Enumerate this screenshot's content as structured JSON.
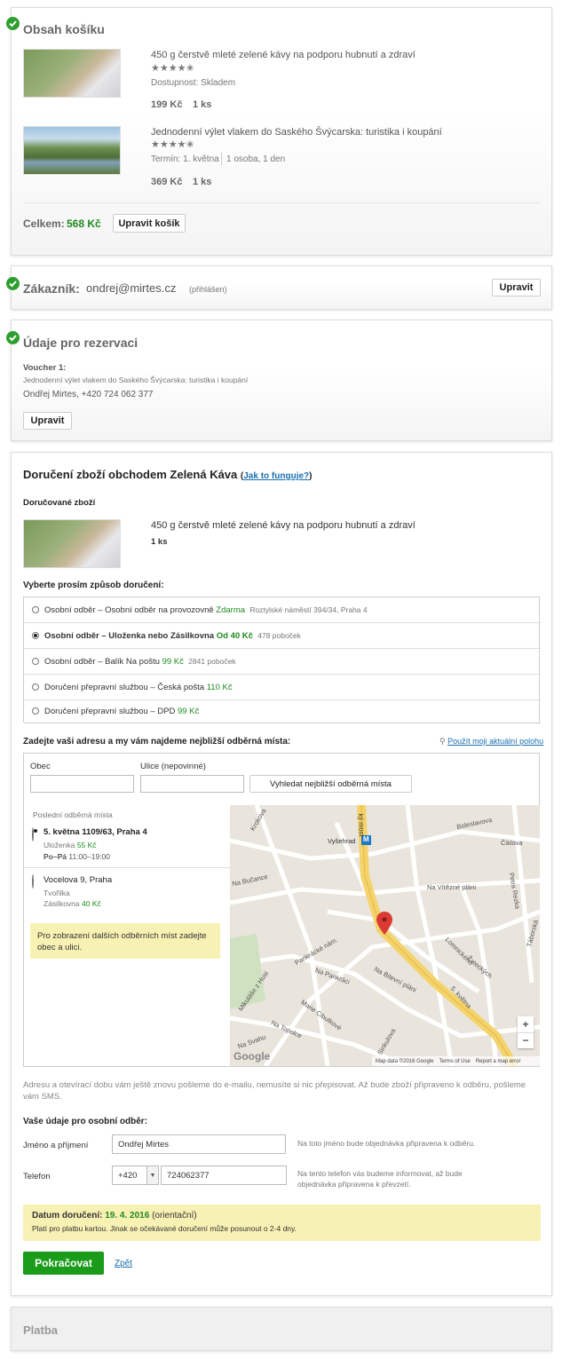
{
  "cart": {
    "title": "Obsah košíku",
    "items": [
      {
        "name": "450 g čerstvě mleté zelené kávy na podporu hubnutí a zdraví",
        "stars": "★★★★✬",
        "availability": "Dostupnost: Skladem",
        "price": "199 Kč",
        "qty": "1 ks"
      },
      {
        "name": "Jednodenní výlet vlakem do Saského Švýcarska: turistika i koupání",
        "stars": "★★★★✬",
        "term": "Termín: 1. května",
        "persons": "1 osoba, 1 den",
        "price": "369 Kč",
        "qty": "1 ks"
      }
    ],
    "total_label": "Celkem:",
    "total_value": "568 Kč",
    "edit_button": "Upravit košík"
  },
  "customer": {
    "label": "Zákazník:",
    "email": "ondrej@mirtes.cz",
    "status": "(přihlášen)",
    "edit_button": "Upravit"
  },
  "reservation": {
    "title": "Údaje pro rezervaci",
    "voucher_label": "Voucher 1:",
    "voucher_name": "Jednodenní výlet vlakem do Saského Švýcarska: turistika i koupání",
    "person": "Ondřej Mirtes, +420 724 062 377",
    "edit_button": "Upravit"
  },
  "delivery": {
    "title": "Doručení zboží obchodem Zelená Káva",
    "how_link": "Jak to funguje?",
    "goods_label": "Doručované zboží",
    "goods_name": "450 g čerstvě mleté zelené kávy na podporu hubnutí a zdraví",
    "goods_qty": "1 ks",
    "choose_label": "Vyberte prosím způsob doručení:",
    "options": [
      {
        "label": "Osobní odběr – Osobní odběr na provozovně",
        "price": "Zdarma",
        "note": "Roztylské náměstí 394/34, Praha 4",
        "selected": false
      },
      {
        "label": "Osobní odběr – Uloženka nebo Zásilkovna",
        "price": "Od 40 Kč",
        "note": "478 poboček",
        "selected": true
      },
      {
        "label": "Osobní odběr – Balík Na poštu",
        "price": "99 Kč",
        "note": "2841 poboček",
        "selected": false
      },
      {
        "label": "Doručení přepravní službou – Česká pošta",
        "price": "110 Kč",
        "note": "",
        "selected": false
      },
      {
        "label": "Doručení přepravní službou – DPD",
        "price": "99 Kč",
        "note": "",
        "selected": false
      }
    ],
    "address_prompt": "Zadejte vaši adresu a my vám najdeme nejbližší odběrná místa:",
    "location_link": "Použít moji aktuální polohu",
    "city_label": "Obec",
    "street_label": "Ulice (nepovinné)",
    "search_button": "Vyhledat nejbližší odběrná místa",
    "recent_label": "Poslední odběrná místa",
    "pickup_points": [
      {
        "name": "5. května 1109/63, Praha 4",
        "provider": "Uloženka",
        "price": "55 Kč",
        "hours_days": "Po–Pá",
        "hours": "11:00–19:00",
        "selected": true
      },
      {
        "name": "Vocelova 9, Praha",
        "provider": "Tvořilka",
        "provider2": "Zásilkovna",
        "price": "40 Kč",
        "selected": false
      }
    ],
    "hint": "Pro zobrazení dalších odběrních míst zadejte obec a ulici.",
    "map": {
      "streets": [
        "Krokova",
        "Vyšehrad",
        "Boleslavova",
        "Čiklova",
        "Na Bučance",
        "Na Vítězné pláni",
        "Petra Rezka",
        "Táborská",
        "Lomnického",
        "Pankrácké nám.",
        "Na Pankráci",
        "Na Bitevní pláni",
        "Mikuláše z Husi",
        "Marie Cibulkové",
        "Na Topolce",
        "Na Svahu",
        "Sinkulova",
        "Žateckých",
        "5. května",
        "ký most"
      ],
      "metro": "M",
      "zoom_in": "+",
      "zoom_out": "−",
      "brand": "Google",
      "attrib": [
        "Map data ©2016 Google",
        "Terms of Use",
        "Report a map error"
      ]
    },
    "info_note": "Adresu a otevírací dobu vám ještě znovu pošleme do e-mailu, nemusíte si nic přepisovat. Až bude zboží připraveno k odběru, pošleme vám SMS.",
    "your_details": "Vaše údaje pro osobní odběr:",
    "name_label": "Jméno a příjmení",
    "name_value": "Ondřej Mirtes",
    "name_help": "Na toto jméno bude objednávka připravena k odběru.",
    "phone_label": "Telefon",
    "phone_prefix": "+420",
    "phone_value": "724062377",
    "phone_help": "Na tento telefon vás budeme informovat, až bude objednávka připravena k převzetí.",
    "date_label": "Datum doručení:",
    "date_value": "19. 4. 2016",
    "date_note": "(orientační)",
    "date_detail": "Platí pro platbu kartou. Jinak se očekávané doručení může posunout o 2-4 dny.",
    "continue_button": "Pokračovat",
    "back_link": "Zpět"
  },
  "payment": {
    "title": "Platba"
  },
  "colors": {
    "accent_green": "#1e8a1e",
    "button_green": "#1a9c1a",
    "link_blue": "#1a6fb0",
    "note_yellow": "#f8f1b4"
  }
}
